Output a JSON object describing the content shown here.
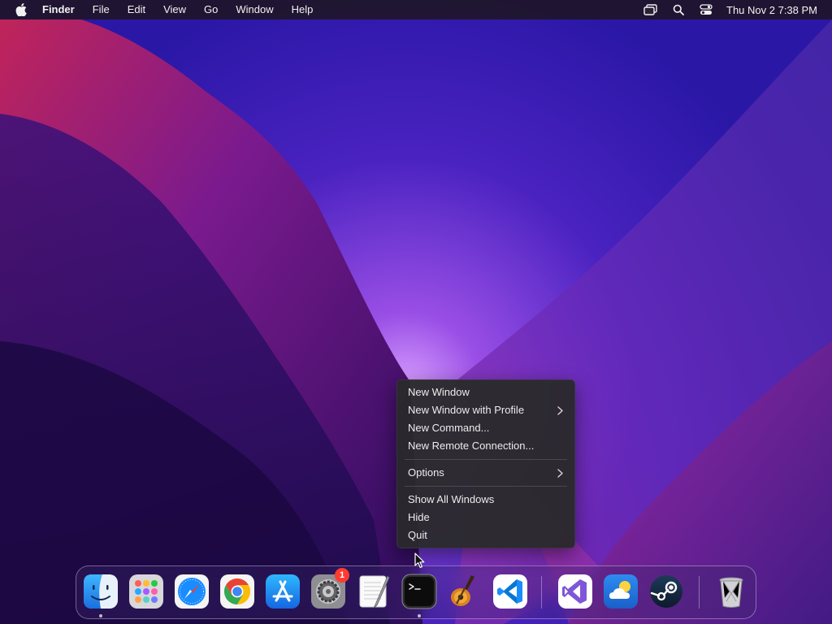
{
  "menubar": {
    "app_name": "Finder",
    "items": [
      "File",
      "Edit",
      "View",
      "Go",
      "Window",
      "Help"
    ],
    "status_icons": [
      "screen-mirroring-icon",
      "spotlight-search-icon",
      "control-center-icon"
    ],
    "clock": "Thu Nov 2  7:38 PM"
  },
  "context_menu": {
    "groups": [
      [
        {
          "label": "New Window",
          "submenu": false
        },
        {
          "label": "New Window with Profile",
          "submenu": true
        },
        {
          "label": "New Command...",
          "submenu": false
        },
        {
          "label": "New Remote Connection...",
          "submenu": false
        }
      ],
      [
        {
          "label": "Options",
          "submenu": true
        }
      ],
      [
        {
          "label": "Show All Windows",
          "submenu": false
        },
        {
          "label": "Hide",
          "submenu": false
        },
        {
          "label": "Quit",
          "submenu": false
        }
      ]
    ]
  },
  "dock": {
    "apps": [
      {
        "icon": "finder-icon",
        "running": true
      },
      {
        "icon": "launchpad-icon",
        "running": false
      },
      {
        "icon": "safari-icon",
        "running": false
      },
      {
        "icon": "chrome-icon",
        "running": false
      },
      {
        "icon": "app-store-icon",
        "running": false
      },
      {
        "icon": "system-settings-icon",
        "running": false,
        "badge": "1"
      },
      {
        "icon": "textedit-icon",
        "running": false
      },
      {
        "icon": "terminal-icon",
        "running": true
      },
      {
        "icon": "garageband-icon",
        "running": false
      },
      {
        "icon": "vscode-icon",
        "running": false
      }
    ],
    "recent_apps": [
      {
        "icon": "visual-studio-icon"
      },
      {
        "icon": "weather-icon"
      },
      {
        "icon": "steam-icon"
      }
    ],
    "trash": {
      "icon": "trash-icon"
    }
  },
  "colors": {
    "menubar_bg": "#1e1628",
    "menu_bg": "#2a2a2c",
    "badge": "#ff3b30",
    "accent_blue": "#1a8cff"
  }
}
